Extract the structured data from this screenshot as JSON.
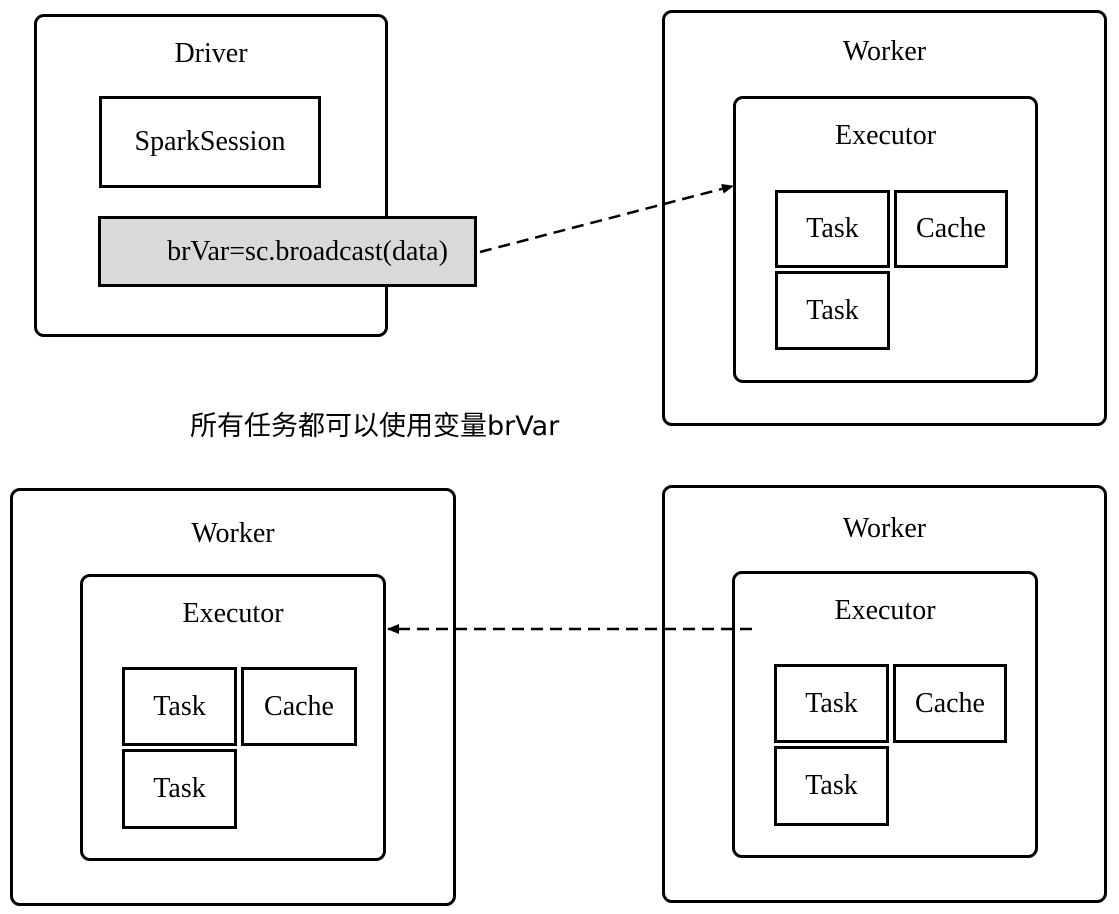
{
  "driver": {
    "title": "Driver",
    "session_label": "SparkSession",
    "broadcast_label": "brVar=sc.broadcast(data)"
  },
  "worker_top_right": {
    "title": "Worker",
    "executor": {
      "title": "Executor",
      "task_1": "Task",
      "cache": "Cache",
      "task_2": "Task"
    }
  },
  "worker_bottom_left": {
    "title": "Worker",
    "executor": {
      "title": "Executor",
      "task_1": "Task",
      "cache": "Cache",
      "task_2": "Task"
    }
  },
  "worker_bottom_right": {
    "title": "Worker",
    "executor": {
      "title": "Executor",
      "task_1": "Task",
      "cache": "Cache",
      "task_2": "Task"
    }
  },
  "caption": "所有任务都可以使用变量brVar"
}
